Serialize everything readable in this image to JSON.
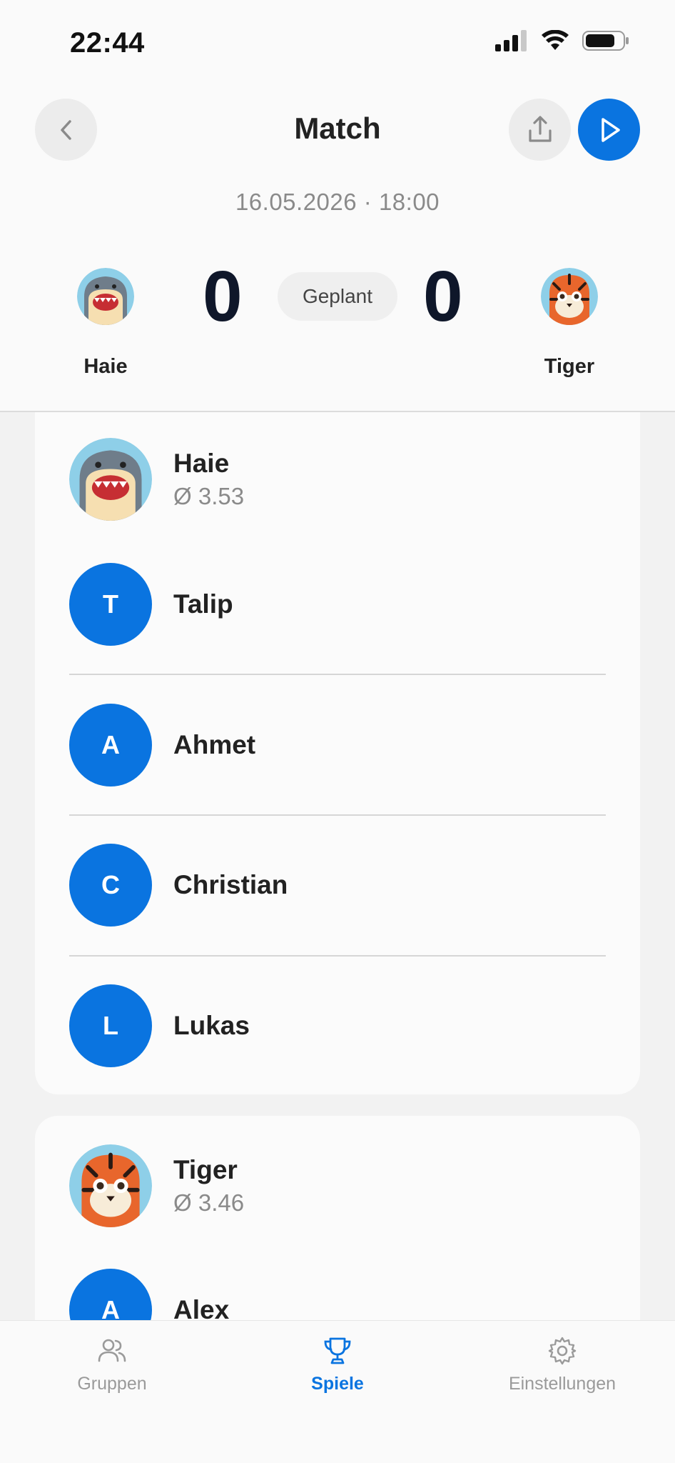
{
  "status_bar": {
    "time": "22:44"
  },
  "nav": {
    "title": "Match"
  },
  "match": {
    "date": "16.05.2026 · 18:00",
    "status": "Geplant",
    "home": {
      "name": "Haie",
      "score": "0"
    },
    "away": {
      "name": "Tiger",
      "score": "0"
    }
  },
  "teams": [
    {
      "name": "Haie",
      "avg": "Ø 3.53",
      "players": [
        {
          "initial": "T",
          "name": "Talip"
        },
        {
          "initial": "A",
          "name": "Ahmet"
        },
        {
          "initial": "C",
          "name": "Christian"
        },
        {
          "initial": "L",
          "name": "Lukas"
        }
      ]
    },
    {
      "name": "Tiger",
      "avg": "Ø 3.46",
      "players": [
        {
          "initial": "A",
          "name": "Alex"
        }
      ]
    }
  ],
  "tabbar": {
    "tabs": [
      {
        "label": "Gruppen",
        "icon": "people-icon"
      },
      {
        "label": "Spiele",
        "icon": "trophy-icon",
        "active": true
      },
      {
        "label": "Einstellungen",
        "icon": "gear-icon"
      }
    ]
  },
  "colors": {
    "accent": "#0a74e0",
    "score": "#0f172a",
    "muted": "#8a8a8a"
  }
}
